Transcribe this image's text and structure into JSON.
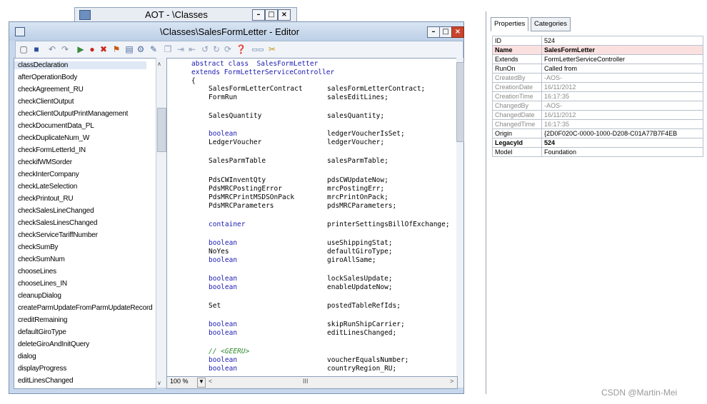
{
  "aot_window": {
    "title": "AOT - \\Classes"
  },
  "editor": {
    "title": "\\Classes\\SalesFormLetter - Editor",
    "zoom": "100 %",
    "methods": [
      "classDeclaration",
      "afterOperationBody",
      "checkAgreement_RU",
      "checkClientOutput",
      "checkClientOutputPrintManagement",
      "checkDocumentData_PL",
      "checkDuplicateNum_W",
      "checkFormLetterId_IN",
      "checkifWMSorder",
      "checkInterCompany",
      "checkLateSelection",
      "checkPrintout_RU",
      "checkSalesLineChanged",
      "checkSalesLinesChanged",
      "checkServiceTariffNumber",
      "checkSumBy",
      "checkSumNum",
      "chooseLines",
      "chooseLines_IN",
      "cleanupDialog",
      "createParmUpdateFromParmUpdateRecord",
      "creditRemaining",
      "defaultGiroType",
      "deleteGiroAndInitQuery",
      "dialog",
      "displayProgress",
      "editLinesChanged"
    ],
    "code_header": [
      "abstract class  SalesFormLetter",
      "extends FormLetterServiceController",
      "{"
    ],
    "code_lines": [
      {
        "type": "SalesFormLetterContract",
        "name": "salesFormLetterContract;",
        "kw": false
      },
      {
        "type": "FormRun",
        "name": "salesEditLines;",
        "kw": false
      },
      {
        "type": "SalesQuantity",
        "name": "salesQuantity;",
        "kw": false
      },
      {
        "type": "boolean",
        "name": "ledgerVoucherIsSet;",
        "kw": true
      },
      {
        "type": "LedgerVoucher",
        "name": "ledgerVoucher;",
        "kw": false
      },
      {
        "type": "SalesParmTable",
        "name": "salesParmTable;",
        "kw": false
      },
      {
        "type": "PdsCWInventQty",
        "name": "pdsCWUpdateNow;",
        "kw": false
      },
      {
        "type": "PdsMRCPostingError",
        "name": "mrcPostingErr;",
        "kw": false
      },
      {
        "type": "PdsMRCPrintMSDSOnPack",
        "name": "mrcPrintOnPack;",
        "kw": false
      },
      {
        "type": "PdsMRCParameters",
        "name": "pdsMRCParameters;",
        "kw": false
      },
      {
        "type": "container",
        "name": "printerSettingsBillOfExchange;",
        "kw": true
      },
      {
        "type": "boolean",
        "name": "useShippingStat;",
        "kw": true
      },
      {
        "type": "NoYes",
        "name": "defaultGiroType;",
        "kw": false
      },
      {
        "type": "boolean",
        "name": "giroAllSame;",
        "kw": true
      },
      {
        "type": "boolean",
        "name": "lockSalesUpdate;",
        "kw": true
      },
      {
        "type": "boolean",
        "name": "enableUpdateNow;",
        "kw": true
      },
      {
        "type": "Set",
        "name": "postedTableRefIds;",
        "kw": false
      },
      {
        "type": "boolean",
        "name": "skipRunShipCarrier;",
        "kw": true
      },
      {
        "type": "boolean",
        "name": "editLinesChanged;",
        "kw": true
      },
      {
        "type": "// <GEERU>",
        "name": "",
        "kw": false,
        "comment": true
      },
      {
        "type": "boolean",
        "name": "voucherEqualsNumber;",
        "kw": true
      },
      {
        "type": "boolean",
        "name": "countryRegion_RU;",
        "kw": true
      }
    ]
  },
  "properties": {
    "tabs": [
      "Properties",
      "Categories"
    ],
    "rows": [
      {
        "key": "ID",
        "value": "524",
        "style": "normal"
      },
      {
        "key": "Name",
        "value": "SalesFormLetter",
        "style": "bold-hl"
      },
      {
        "key": "Extends",
        "value": "FormLetterServiceController",
        "style": "normal"
      },
      {
        "key": "RunOn",
        "value": "Called from",
        "style": "normal"
      },
      {
        "key": "CreatedBy",
        "value": "-AOS-",
        "style": "grey"
      },
      {
        "key": "CreationDate",
        "value": "16/11/2012",
        "style": "grey"
      },
      {
        "key": "CreationTime",
        "value": "16:17:35",
        "style": "grey"
      },
      {
        "key": "ChangedBy",
        "value": "-AOS-",
        "style": "grey"
      },
      {
        "key": "ChangedDate",
        "value": "16/11/2012",
        "style": "grey"
      },
      {
        "key": "ChangedTime",
        "value": "16:17:35",
        "style": "grey"
      },
      {
        "key": "Origin",
        "value": "{2D0F020C-0000-1000-D208-C01A77B7F4EB",
        "style": "normal"
      },
      {
        "key": "LegacyId",
        "value": "524",
        "style": "bold"
      },
      {
        "key": "Model",
        "value": "Foundation",
        "style": "normal"
      }
    ]
  },
  "watermark": "CSDN @Martin-Mei",
  "icons": [
    "new-icon",
    "save-icon",
    "undo-icon",
    "redo-icon",
    "run-icon",
    "breakpoint-icon",
    "help-icon"
  ]
}
